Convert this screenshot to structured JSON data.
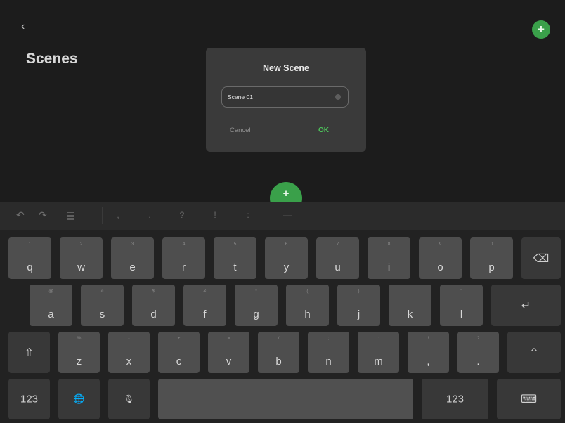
{
  "app": {
    "title": "Scenes",
    "back_icon": "‹",
    "add_icon": "+"
  },
  "dialog": {
    "title": "New Scene",
    "input_value": "Scene 01",
    "cancel_label": "Cancel",
    "ok_label": "OK"
  },
  "fab": {
    "icon": "+"
  },
  "shortcut_bar": {
    "undo_icon": "↶",
    "redo_icon": "↷",
    "paste_icon": "▤",
    "punctuation": [
      ",",
      ".",
      "?",
      "!",
      ":",
      "—"
    ]
  },
  "keyboard": {
    "row1": [
      {
        "k": "q",
        "sub": "1"
      },
      {
        "k": "w",
        "sub": "2"
      },
      {
        "k": "e",
        "sub": "3"
      },
      {
        "k": "r",
        "sub": "4"
      },
      {
        "k": "t",
        "sub": "5"
      },
      {
        "k": "y",
        "sub": "6"
      },
      {
        "k": "u",
        "sub": "7"
      },
      {
        "k": "i",
        "sub": "8"
      },
      {
        "k": "o",
        "sub": "9"
      },
      {
        "k": "p",
        "sub": "0"
      }
    ],
    "row2": [
      {
        "k": "a",
        "sub": "@"
      },
      {
        "k": "s",
        "sub": "#"
      },
      {
        "k": "d",
        "sub": "$"
      },
      {
        "k": "f",
        "sub": "&"
      },
      {
        "k": "g",
        "sub": "*"
      },
      {
        "k": "h",
        "sub": "("
      },
      {
        "k": "j",
        "sub": ")"
      },
      {
        "k": "k",
        "sub": "'"
      },
      {
        "k": "l",
        "sub": "\""
      }
    ],
    "row3": [
      {
        "k": "z",
        "sub": "%"
      },
      {
        "k": "x",
        "sub": "-"
      },
      {
        "k": "c",
        "sub": "+"
      },
      {
        "k": "v",
        "sub": "="
      },
      {
        "k": "b",
        "sub": "/"
      },
      {
        "k": "n",
        "sub": ";"
      },
      {
        "k": "m",
        "sub": ":"
      },
      {
        "k": ",",
        "sub": "!"
      },
      {
        "k": ".",
        "sub": "?"
      }
    ],
    "backspace_icon": "⌫",
    "return_icon": "↵",
    "shift_icon": "⇧",
    "numbers_label": "123",
    "globe_icon": "🌐",
    "mic_icon": "🎙",
    "space_label": "",
    "dismiss_icon": "⌨"
  }
}
